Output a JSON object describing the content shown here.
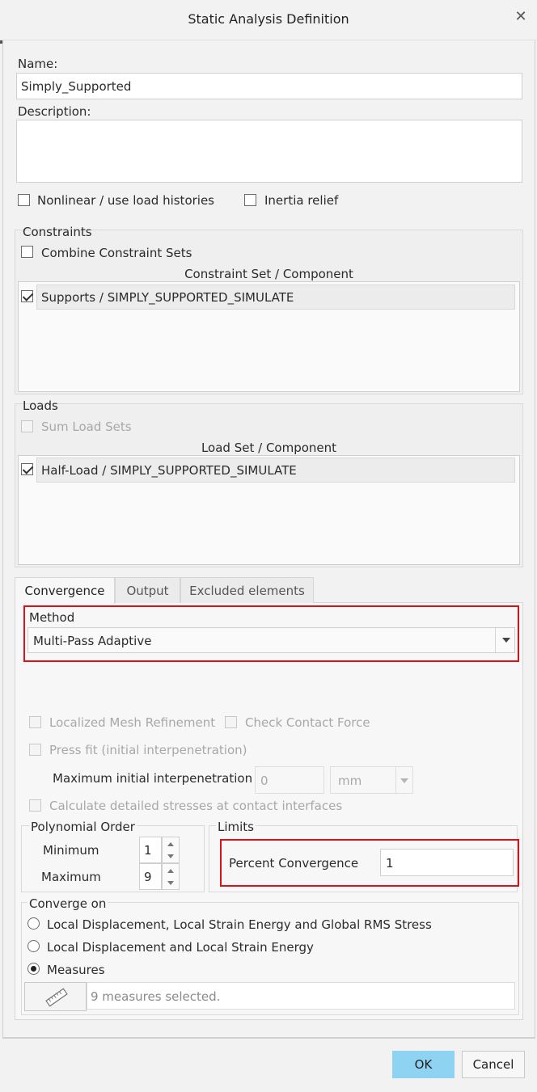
{
  "dialog": {
    "title": "Static Analysis Definition",
    "close_icon": "close-icon"
  },
  "name": {
    "label": "Name:",
    "value": "Simply_Supported"
  },
  "description": {
    "label": "Description:",
    "value": ""
  },
  "options": {
    "nonlinear": "Nonlinear / use load histories",
    "inertia": "Inertia relief"
  },
  "constraints": {
    "title": "Constraints",
    "combine_label": "Combine Constraint Sets",
    "column_header": "Constraint Set / Component",
    "items": [
      {
        "label": "Supports / SIMPLY_SUPPORTED_SIMULATE",
        "checked": true
      }
    ]
  },
  "loads": {
    "title": "Loads",
    "sum_label": "Sum Load Sets",
    "column_header": "Load Set / Component",
    "items": [
      {
        "label": "Half-Load / SIMPLY_SUPPORTED_SIMULATE",
        "checked": true
      }
    ]
  },
  "tabs": [
    {
      "label": "Convergence",
      "active": true
    },
    {
      "label": "Output"
    },
    {
      "label": "Excluded elements"
    }
  ],
  "convergence": {
    "method_label": "Method",
    "method_value": "Multi-Pass Adaptive",
    "localized_mesh": "Localized Mesh Refinement",
    "check_contact": "Check Contact Force",
    "press_fit": "Press fit (initial interpenetration)",
    "max_interpen_label": "Maximum initial interpenetration",
    "max_interpen_value": "0",
    "unit": "mm",
    "detailed_stresses": "Calculate detailed stresses at contact interfaces",
    "poly_title": "Polynomial Order",
    "min_label": "Minimum",
    "min_value": "1",
    "max_label": "Maximum",
    "max_value": "9",
    "limits_title": "Limits",
    "percent_label": "Percent Convergence",
    "percent_value": "1",
    "converge_on_title": "Converge on",
    "radio_options": [
      "Local Displacement, Local Strain Energy and Global RMS Stress",
      "Local Displacement and Local Strain Energy",
      "Measures"
    ],
    "selected_radio": "Measures",
    "measures_text": "9 measures selected."
  },
  "buttons": {
    "ok": "OK",
    "cancel": "Cancel"
  }
}
